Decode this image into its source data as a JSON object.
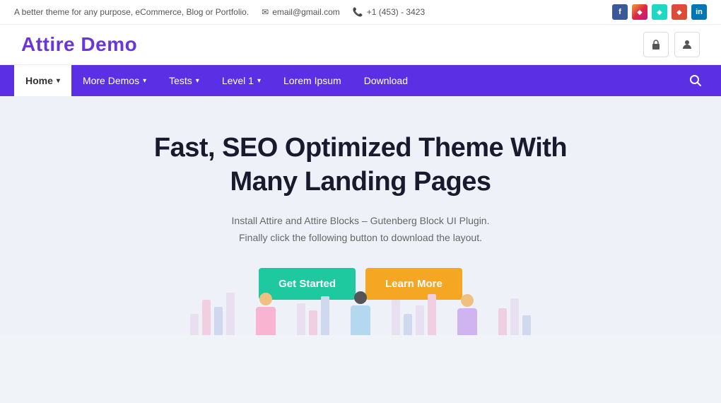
{
  "topbar": {
    "tagline": "A better theme for any purpose, eCommerce, Blog or Portfolio.",
    "email": "email@gmail.com",
    "phone": "+1 (453) - 3423",
    "email_icon": "✉",
    "phone_icon": "📞"
  },
  "social": [
    {
      "name": "facebook",
      "label": "f",
      "class": "si-fb"
    },
    {
      "name": "instagram",
      "label": "◆",
      "class": "si-ig"
    },
    {
      "name": "diamond",
      "label": "◆",
      "class": "si-d"
    },
    {
      "name": "googleplus",
      "label": "◆",
      "class": "si-gp"
    },
    {
      "name": "linkedin",
      "label": "in",
      "class": "si-li"
    }
  ],
  "header": {
    "logo": "Attire Demo",
    "lock_icon": "🔒",
    "user_icon": "👤"
  },
  "nav": {
    "items": [
      {
        "label": "Home",
        "active": true,
        "has_dropdown": true
      },
      {
        "label": "More Demos",
        "active": false,
        "has_dropdown": true
      },
      {
        "label": "Tests",
        "active": false,
        "has_dropdown": true
      },
      {
        "label": "Level 1",
        "active": false,
        "has_dropdown": true
      },
      {
        "label": "Lorem Ipsum",
        "active": false,
        "has_dropdown": false
      },
      {
        "label": "Download",
        "active": false,
        "has_dropdown": false
      }
    ],
    "search_icon": "🔍"
  },
  "hero": {
    "title": "Fast, SEO Optimized Theme With Many Landing Pages",
    "subtitle_line1": "Install Attire and Attire Blocks – Gutenberg Block UI Plugin.",
    "subtitle_line2": "Finally click the following button to download the layout.",
    "btn_primary": "Get Started",
    "btn_secondary": "Learn More",
    "colors": {
      "accent_purple": "#6b35d9",
      "nav_bg": "#5b30e5",
      "btn_green": "#1ec9a0",
      "btn_orange": "#f5a623"
    }
  }
}
